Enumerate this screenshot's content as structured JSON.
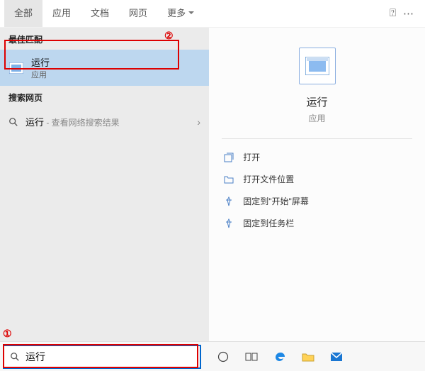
{
  "tabs": {
    "all": "全部",
    "apps": "应用",
    "documents": "文档",
    "web": "网页",
    "more": "更多"
  },
  "left": {
    "bestMatchHeader": "最佳匹配",
    "bestMatch": {
      "title": "运行",
      "subtitle": "应用"
    },
    "webHeader": "搜索网页",
    "webRow": {
      "term": "运行",
      "hint": " - 查看网络搜索结果"
    }
  },
  "right": {
    "title": "运行",
    "subtitle": "应用",
    "actions": {
      "open": "打开",
      "openLocation": "打开文件位置",
      "pinStart": "固定到\"开始\"屏幕",
      "pinTaskbar": "固定到任务栏"
    }
  },
  "search": {
    "value": "运行"
  },
  "annotations": {
    "one": "①",
    "two": "②"
  }
}
